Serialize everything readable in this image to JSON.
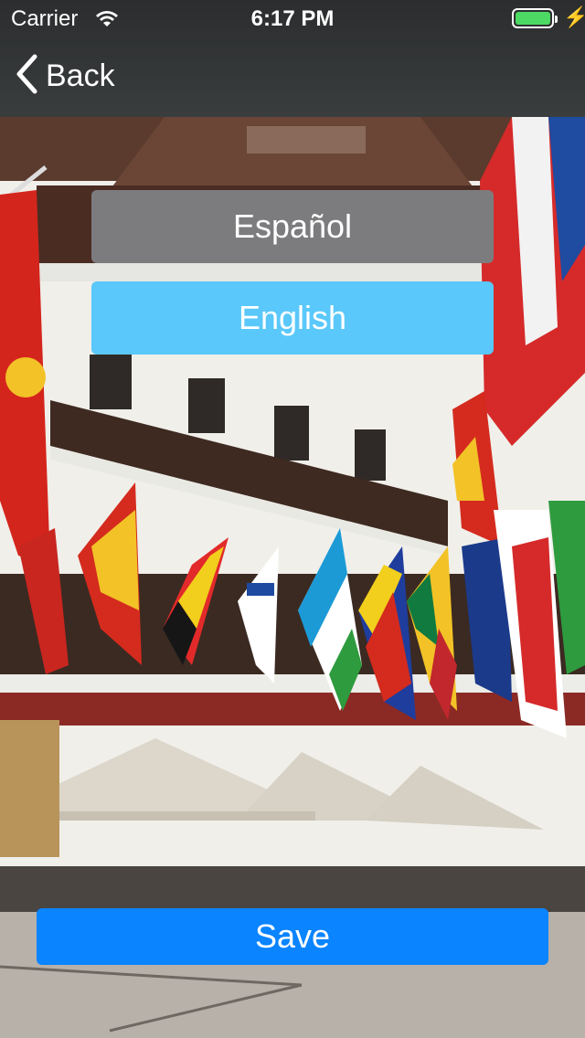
{
  "status_bar": {
    "carrier": "Carrier",
    "time": "6:17 PM"
  },
  "nav": {
    "back_label": "Back"
  },
  "languages": [
    {
      "label": "Español",
      "selected": false
    },
    {
      "label": "English",
      "selected": true
    }
  ],
  "save_label": "Save",
  "colors": {
    "accent": "#0a84ff",
    "selected": "#5ac8fa",
    "unselected": "#7c7c7e",
    "battery": "#4cd964"
  }
}
